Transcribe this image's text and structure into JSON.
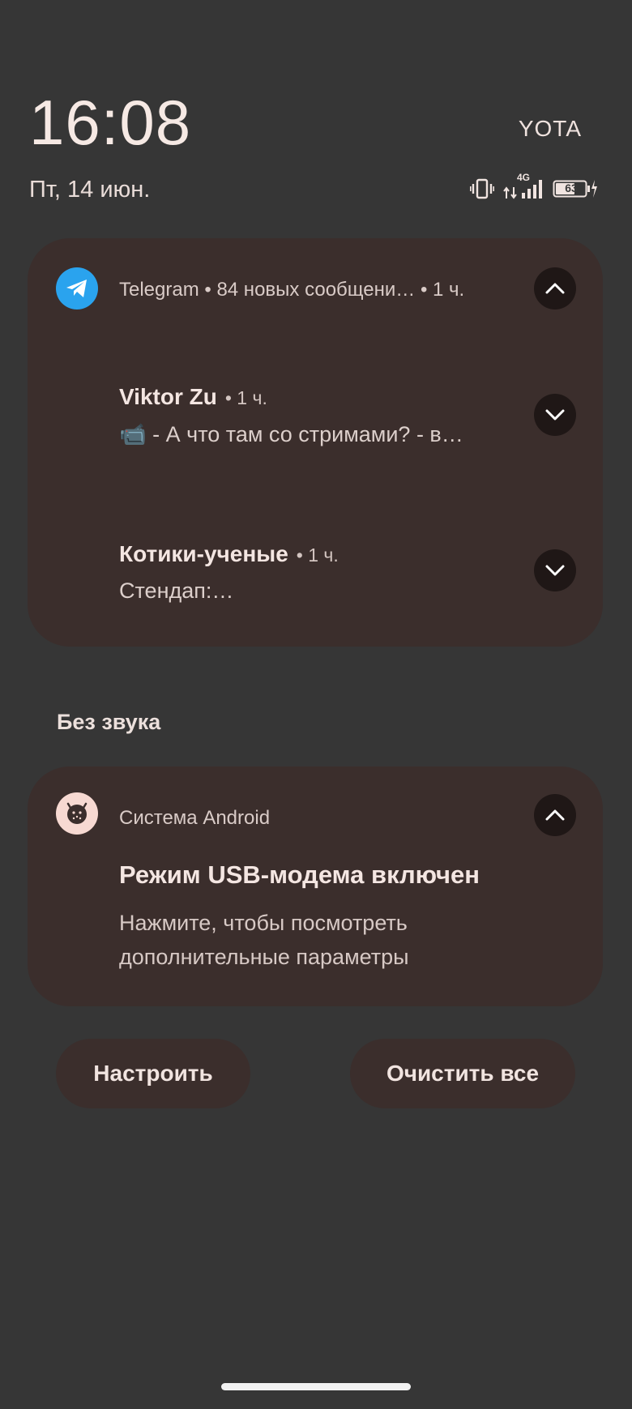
{
  "status": {
    "time": "16:08",
    "carrier": "YOTA",
    "date": "Пт, 14 июн.",
    "network": "4G",
    "battery": "63"
  },
  "telegram": {
    "header": "Telegram • 84 новых сообщени… • 1 ч.",
    "messages": [
      {
        "sender": "Viktor Zu",
        "time": "• 1 ч.",
        "text": "📹 - А что там со стримами? - в…"
      },
      {
        "sender": "Котики-ученые",
        "time": "• 1 ч.",
        "text": "Стендап:…"
      }
    ]
  },
  "silent_section": {
    "label": "Без звука"
  },
  "system": {
    "app": "Система Android",
    "title": "Режим USB-модема включен",
    "text": "Нажмите, чтобы посмотреть дополнительные параметры"
  },
  "actions": {
    "settings": "Настроить",
    "clear_all": "Очистить все"
  },
  "colors": {
    "background": "#363636",
    "card": "#3b2e2c",
    "telegram_blue": "#2aa3ee",
    "button_dark": "#1f1716"
  }
}
